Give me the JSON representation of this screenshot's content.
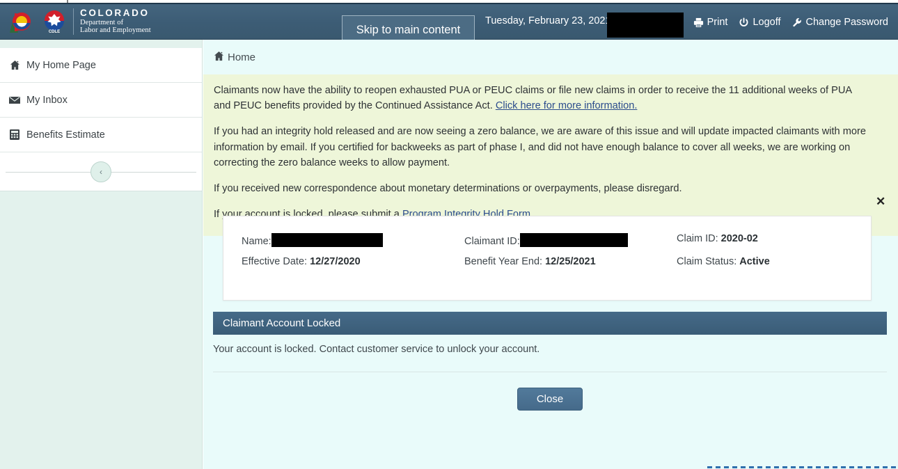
{
  "header": {
    "brand": {
      "line1": "COLORADO",
      "line2": "Department of",
      "line3": "Labor and Employment",
      "seal_label": "CDLE"
    },
    "skip_link": "Skip to main content",
    "date": "Tuesday, February 23, 2021",
    "user_redacted": "",
    "actions": [
      {
        "label": "Print",
        "icon": "printer-icon"
      },
      {
        "label": "Logoff",
        "icon": "power-icon"
      },
      {
        "label": "Change Password",
        "icon": "wrench-icon"
      }
    ],
    "colors": {
      "bar": "#3f6079",
      "text": "#ffffff"
    }
  },
  "sidebar": {
    "items": [
      {
        "label": "My Home Page",
        "icon": "home-icon"
      },
      {
        "label": "My Inbox",
        "icon": "envelope-icon"
      },
      {
        "label": "Benefits Estimate",
        "icon": "calculator-icon"
      }
    ],
    "collapse_label": "‹",
    "colors": {
      "bg": "#e3f2ed",
      "item_bg": "#ffffff"
    }
  },
  "main": {
    "breadcrumb": {
      "icon": "home-icon",
      "label": "Home"
    },
    "alert": {
      "close_label": "✕",
      "paragraph1_before": "Claimants now have the ability to reopen exhausted PUA or PEUC claims or file new claims in order to receive the 11 additional weeks of PUA and PEUC benefits provided by the Continued Assistance Act. ",
      "paragraph1_link": "Click here for more information.",
      "paragraph2": "If you had an integrity hold released and are now seeing a zero balance, we are aware of this issue and will update impacted claimants with more information by email.  If you certified for backweeks as part of phase I, and did not have enough balance to cover all weeks, we are working on correcting the zero balance weeks to allow payment.",
      "paragraph3": "If you received new correspondence about monetary determinations or overpayments, please disregard.",
      "paragraph4_before": "If your account is locked, please submit a ",
      "paragraph4_link": "Program Integrity Hold Form",
      "paragraph4_after": ".",
      "colors": {
        "bg": "#eef6d9",
        "link": "#2b4c8c"
      }
    },
    "claim_card": {
      "name_label": "Name:",
      "name_value": "",
      "claimant_id_label": "Claimant ID:",
      "claimant_id_value": "",
      "claim_id_label": "Claim ID:",
      "claim_id_value": "2020-02",
      "effective_date_label": "Effective Date:",
      "effective_date_value": "12/27/2020",
      "benefit_year_end_label": "Benefit Year End:",
      "benefit_year_end_value": "12/25/2021",
      "claim_status_label": "Claim Status:",
      "claim_status_value": "Active"
    },
    "locked_panel": {
      "title": "Claimant Account Locked",
      "message": "Your account is locked. Contact customer service to unlock your account.",
      "close_button": "Close",
      "colors": {
        "header_bg": "#3d6280",
        "button_bg": "#4a7091"
      }
    },
    "colors": {
      "bg": "#e9fbfa"
    }
  }
}
